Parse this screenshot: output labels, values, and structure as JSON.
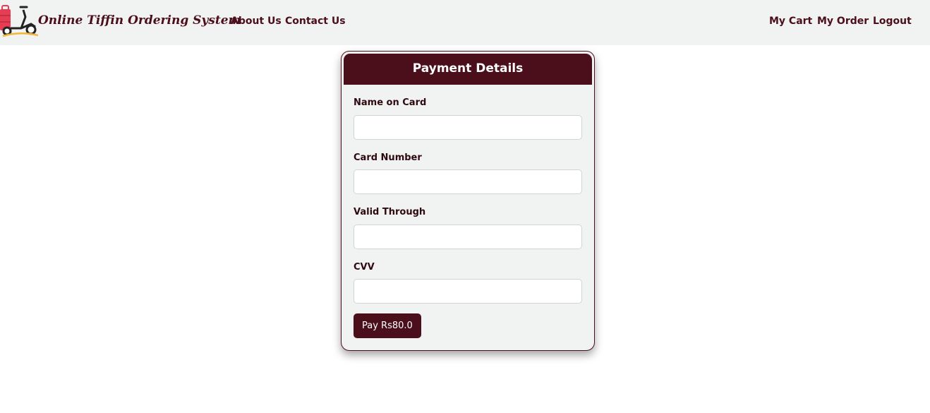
{
  "header": {
    "brand": "Online Tiffin Ordering System",
    "nav_left": [
      "About Us",
      "Contact Us"
    ],
    "nav_right": [
      "My Cart",
      "My Order",
      "Logout"
    ]
  },
  "payment": {
    "title": "Payment Details",
    "fields": [
      {
        "label": "Name on Card",
        "value": ""
      },
      {
        "label": "Card Number",
        "value": ""
      },
      {
        "label": "Valid Through",
        "value": ""
      },
      {
        "label": "CVV",
        "value": ""
      }
    ],
    "pay_button": "Pay Rs80.0"
  },
  "colors": {
    "primary": "#4b0f1b",
    "nav_bg": "#f1f2f2",
    "logo_red": "#e43d54",
    "logo_yellow": "#f2b635"
  }
}
